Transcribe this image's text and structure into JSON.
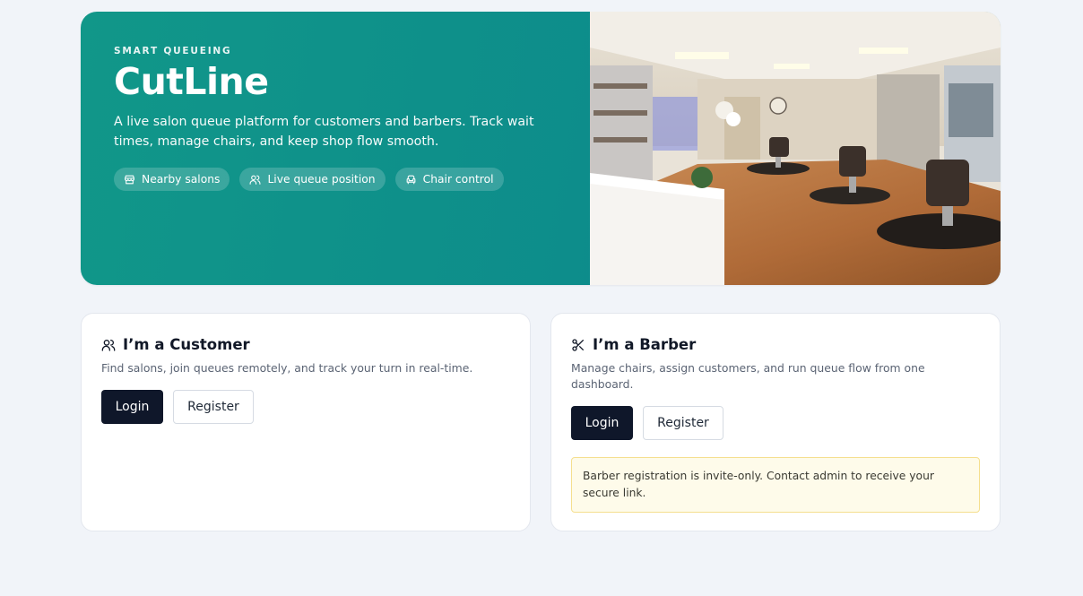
{
  "hero": {
    "eyebrow": "SMART QUEUEING",
    "brand": "CutLine",
    "tagline": "A live salon queue platform for customers and barbers. Track wait times, manage chairs, and keep shop flow smooth.",
    "chips": [
      {
        "label": "Nearby salons",
        "icon": "store-icon"
      },
      {
        "label": "Live queue position",
        "icon": "users-icon"
      },
      {
        "label": "Chair control",
        "icon": "armchair-icon"
      }
    ],
    "photo_icon": "salon-interior-photo"
  },
  "customer": {
    "title": "I’m a Customer",
    "icon": "users-icon",
    "description": "Find salons, join queues remotely, and track your turn in real-time.",
    "login_label": "Login",
    "register_label": "Register"
  },
  "barber": {
    "title": "I’m a Barber",
    "icon": "scissors-icon",
    "description": "Manage chairs, assign customers, and run queue flow from one dashboard.",
    "login_label": "Login",
    "register_label": "Register",
    "notice": "Barber registration is invite-only. Contact admin to receive your secure link."
  },
  "colors": {
    "hero_start": "#119789",
    "hero_end": "#0b838c",
    "primary_button": "#0f172a",
    "notice_bg": "#fefbea",
    "notice_border": "#f5df8e",
    "page_bg": "#f1f4f9"
  }
}
